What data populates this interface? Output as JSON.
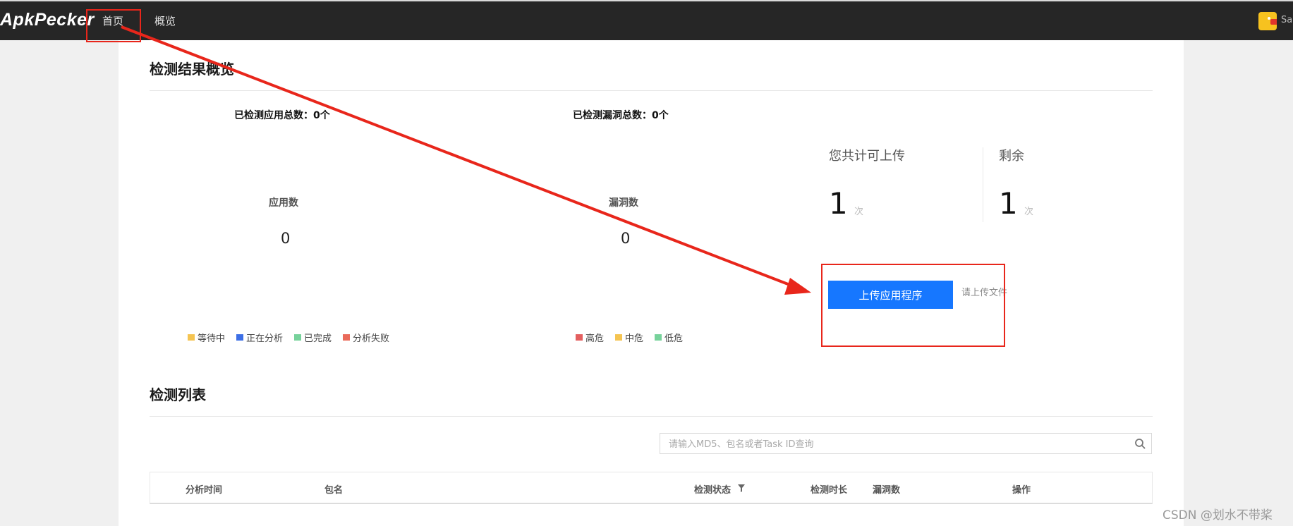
{
  "topbar": {
    "logo": "ApkPecker",
    "nav": [
      "首页",
      "概览"
    ],
    "username": "Sa"
  },
  "overview": {
    "title": "检测结果概览",
    "apps_total_label": "已检测应用总数：0个",
    "vulns_total_label": "已检测漏洞总数：0个",
    "app_chart": {
      "title": "应用数",
      "value": "0"
    },
    "vuln_chart": {
      "title": "漏洞数",
      "value": "0"
    },
    "app_legend": [
      {
        "label": "等待中",
        "color": "#f5c451"
      },
      {
        "label": "正在分析",
        "color": "#3d6fe6"
      },
      {
        "label": "已完成",
        "color": "#77d29b"
      },
      {
        "label": "分析失败",
        "color": "#ea6a5a"
      }
    ],
    "vuln_legend": [
      {
        "label": "高危",
        "color": "#e35f5f"
      },
      {
        "label": "中危",
        "color": "#f5c451"
      },
      {
        "label": "低危",
        "color": "#77d29b"
      }
    ]
  },
  "quota": {
    "total_label": "您共计可上传",
    "total_value": "1",
    "remaining_label": "剩余",
    "remaining_value": "1",
    "unit": "次"
  },
  "upload": {
    "button_label": "上传应用程序",
    "hint": "请上传文件"
  },
  "detection_list": {
    "title": "检测列表",
    "search_placeholder": "请输入MD5、包名或者Task ID查询",
    "columns": [
      "分析时间",
      "包名",
      "检测状态",
      "检测时长",
      "漏洞数",
      "操作"
    ]
  },
  "watermark": "CSDN @划水不带桨",
  "colors": {
    "topbar": "#262626",
    "primary": "#1677ff",
    "annotation": "#e8261b"
  }
}
